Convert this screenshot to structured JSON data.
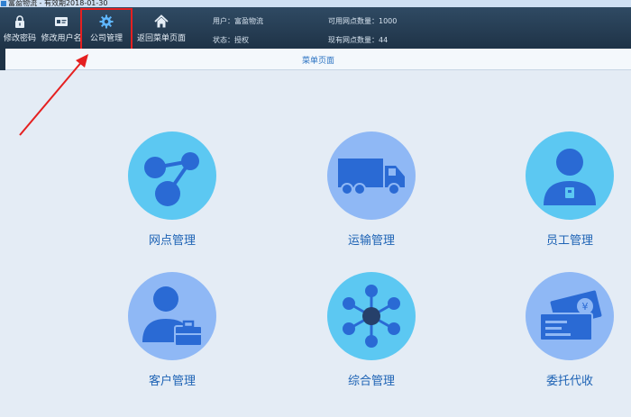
{
  "window": {
    "title": "富盈物流 - 有效期2018-01-30"
  },
  "toolbar": {
    "buttons": [
      {
        "label": "修改密码",
        "icon": "lock-icon"
      },
      {
        "label": "修改用户名",
        "icon": "id-card-icon"
      },
      {
        "label": "公司管理",
        "icon": "gear-icon"
      },
      {
        "label": "返回菜单页面",
        "icon": "home-icon"
      }
    ]
  },
  "info": {
    "user": "用户：富盈物流",
    "status": "状态：授权",
    "total_outlets": "可用网点数量：1000",
    "used_outlets": "现有网点数量：44"
  },
  "subbar": {
    "label": "菜单页面"
  },
  "tiles": [
    {
      "label": "网点管理",
      "icon": "network-nodes-icon"
    },
    {
      "label": "运输管理",
      "icon": "truck-icon"
    },
    {
      "label": "员工管理",
      "icon": "employee-icon"
    },
    {
      "label": "客户管理",
      "icon": "customer-briefcase-icon"
    },
    {
      "label": "综合管理",
      "icon": "hub-icon"
    },
    {
      "label": "委托代收",
      "icon": "payment-card-icon"
    }
  ],
  "colors": {
    "toolbar_bg": "#1f3347",
    "background": "#e4ecf5",
    "tile_light": "#5cc8f2",
    "tile_blue": "#8fb8f5",
    "label_blue": "#1e63b5",
    "annotation_red": "#e52020"
  }
}
